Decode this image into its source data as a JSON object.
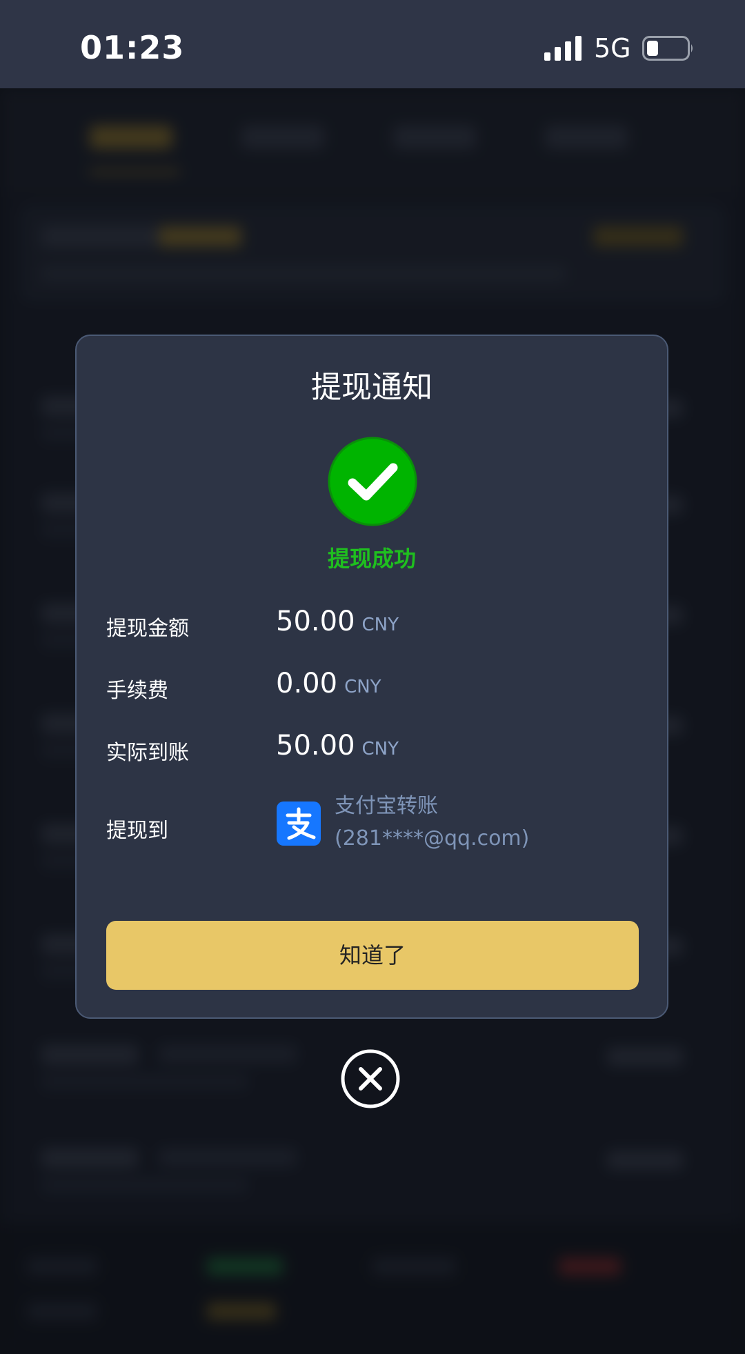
{
  "status_bar": {
    "time": "01:23",
    "network": "5G",
    "signal_icon": "signal-bars-icon",
    "battery_icon": "battery-low-icon"
  },
  "dialog": {
    "title": "提现通知",
    "status_icon": "check-circle-icon",
    "status_color": "#00b400",
    "status_text": "提现成功",
    "rows": [
      {
        "label": "提现金额",
        "value": "50.00",
        "unit": "CNY"
      },
      {
        "label": "手续费",
        "value": "0.00",
        "unit": "CNY"
      },
      {
        "label": "实际到账",
        "value": "50.00",
        "unit": "CNY"
      }
    ],
    "destination": {
      "label": "提现到",
      "method_icon": "alipay-icon",
      "method": "支付宝转账",
      "account": "(281****@qq.com)"
    },
    "confirm_label": "知道了",
    "confirm_color": "#e8c767",
    "close_icon": "close-circle-icon"
  }
}
